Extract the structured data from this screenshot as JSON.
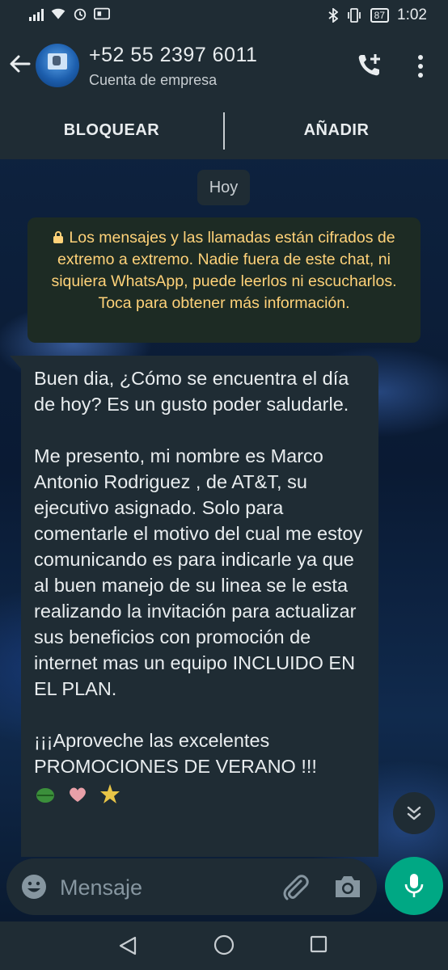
{
  "status_bar": {
    "time": "1:02",
    "battery": "87",
    "icons": [
      "signal-icon",
      "wifi-icon",
      "alarm-icon",
      "sim-icon",
      "bluetooth-icon",
      "vibrate-icon",
      "battery-icon"
    ]
  },
  "header": {
    "contact_name": "+52 55 2397 6011",
    "contact_subtitle": "Cuenta de empresa",
    "icons": [
      "back-arrow-icon",
      "add-call-icon",
      "more-vert-icon"
    ]
  },
  "actions": {
    "block_label": "BLOQUEAR",
    "add_label": "AÑADIR"
  },
  "date_chip": "Hoy",
  "encryption_notice": "Los mensajes y las llamadas están cifrados de extremo a extremo. Nadie fuera de este chat, ni siquiera WhatsApp, puede leerlos ni escucharlos. Toca para obtener más información.",
  "message": {
    "paragraphs": [
      "Buen dia, ¿Cómo se encuentra el día de hoy? Es un gusto poder saludarle.",
      "Me presento, mi nombre es Marco Antonio Rodriguez , de AT&T, su ejecutivo asignado. Solo para comentarle el motivo del cual me estoy comunicando es para indicarle ya que al buen manejo de su linea se le esta realizando la invitación para actualizar sus beneficios con promoción de internet mas un equipo INCLUIDO EN EL PLAN.",
      "¡¡¡Aproveche las excelentes PROMOCIONES DE VERANO !!!"
    ],
    "emojis": [
      "leaf-emoji",
      "heart-emoji",
      "star-emoji"
    ]
  },
  "composer": {
    "placeholder": "Mensaje",
    "icons": [
      "emoji-icon",
      "attach-icon",
      "camera-icon",
      "mic-icon"
    ]
  },
  "colors": {
    "bar_bg": "#1f2c34",
    "accent": "#00a884",
    "notice_text": "#ffd279",
    "notice_bg": "#1d2b24"
  }
}
